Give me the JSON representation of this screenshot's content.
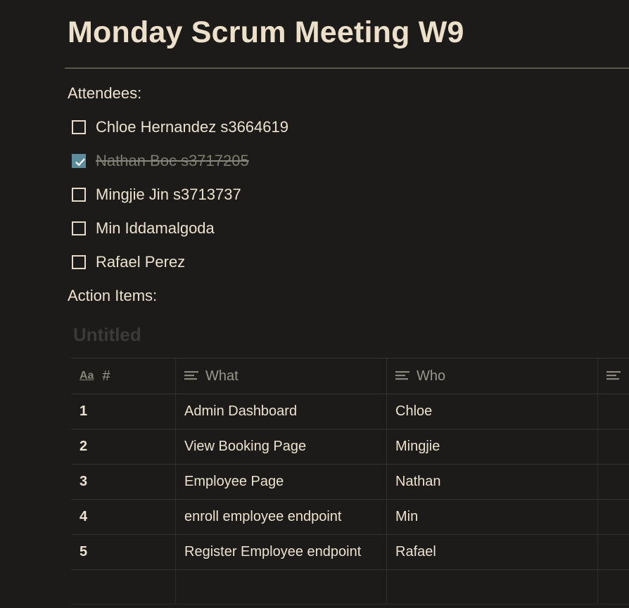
{
  "page": {
    "title": "Monday Scrum Meeting W9"
  },
  "attendees": {
    "label": "Attendees:",
    "items": [
      {
        "text": "Chloe Hernandez s3664619",
        "checked": false
      },
      {
        "text": "Nathan Boc s3717205",
        "checked": true
      },
      {
        "text": "Mingjie Jin s3713737",
        "checked": false
      },
      {
        "text": "Min Iddamalgoda",
        "checked": false
      },
      {
        "text": "Rafael Perez",
        "checked": false
      }
    ]
  },
  "action_items": {
    "label": "Action Items:",
    "database_title": "Untitled",
    "columns": [
      {
        "label": "#",
        "icon": "title-aa-icon",
        "icon_text": "Aa"
      },
      {
        "label": "What",
        "icon": "text-lines-icon"
      },
      {
        "label": "Who",
        "icon": "text-lines-icon"
      },
      {
        "label": "",
        "icon": "text-lines-icon"
      }
    ],
    "rows": [
      {
        "num": "1",
        "what": "Admin Dashboard",
        "who": "Chloe"
      },
      {
        "num": "2",
        "what": "View Booking Page",
        "who": "Mingjie"
      },
      {
        "num": "3",
        "what": "Employee Page",
        "who": "Nathan"
      },
      {
        "num": "4",
        "what": "enroll employee endpoint",
        "who": "Min"
      },
      {
        "num": "5",
        "what": "Register Employee endpoint",
        "who": "Rafael"
      }
    ]
  },
  "colors": {
    "background": "#1c1b19",
    "text": "#ede2cf",
    "checkbox_checked": "#5b8c9a",
    "muted": "#9b968b"
  }
}
